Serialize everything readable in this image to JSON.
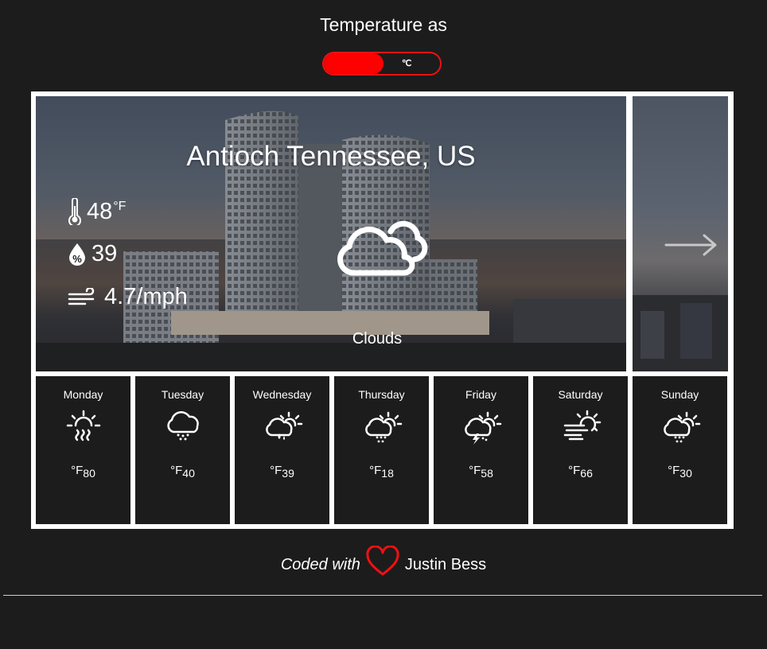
{
  "header": {
    "title": "Temperature as"
  },
  "unit_toggle": {
    "label": "℃",
    "selected": "°F"
  },
  "current": {
    "location": "Antioch Tennessee, US",
    "temperature": "48",
    "temperature_unit": "°F",
    "humidity": "39",
    "wind": "4.7/mph",
    "condition": "Clouds",
    "condition_icon": "clouds-icon"
  },
  "forecast": [
    {
      "day": "Monday",
      "unit": "°F",
      "temp": "80",
      "icon": "sunny-haze-icon"
    },
    {
      "day": "Tuesday",
      "unit": "°F",
      "temp": "40",
      "icon": "cloud-snow-icon"
    },
    {
      "day": "Wednesday",
      "unit": "°F",
      "temp": "39",
      "icon": "partly-cloudy-rain-icon"
    },
    {
      "day": "Thursday",
      "unit": "°F",
      "temp": "18",
      "icon": "partly-cloudy-snow-icon"
    },
    {
      "day": "Friday",
      "unit": "°F",
      "temp": "58",
      "icon": "partly-cloudy-thunder-icon"
    },
    {
      "day": "Saturday",
      "unit": "°F",
      "temp": "66",
      "icon": "sun-wind-icon"
    },
    {
      "day": "Sunday",
      "unit": "°F",
      "temp": "30",
      "icon": "partly-cloudy-snow-icon"
    }
  ],
  "footer": {
    "coded_with": "Coded with",
    "author": "Justin Bess",
    "heart_icon": "heart-icon"
  },
  "colors": {
    "background": "#1c1c1c",
    "accent": "#ff0000",
    "frame": "#ffffff"
  }
}
